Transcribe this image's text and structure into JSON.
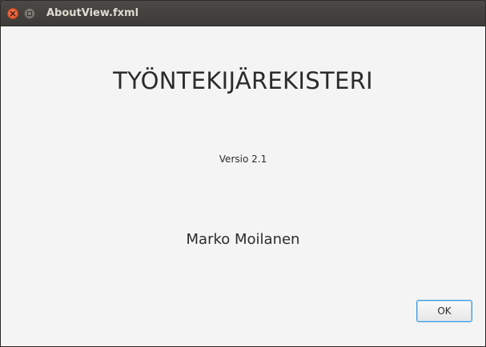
{
  "window": {
    "title": "AboutView.fxml",
    "controls": [
      "close-icon",
      "minimize-icon"
    ]
  },
  "about": {
    "app_title": "TYÖNTEKIJÄREKISTERI",
    "version": "Versio 2.1",
    "author": "Marko Moilanen"
  },
  "actions": {
    "ok_label": "OK"
  },
  "colors": {
    "titlebar": "#3c3b37",
    "background": "#f4f4f4",
    "close_button": "#e95420",
    "focus_border": "#3d9be0"
  }
}
